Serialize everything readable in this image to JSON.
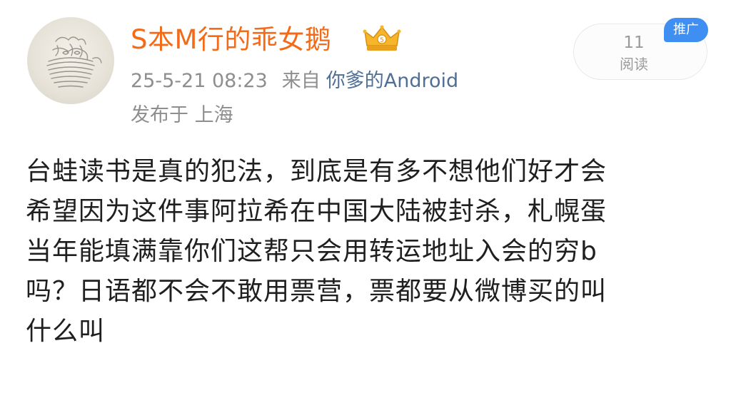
{
  "post": {
    "author": {
      "name": "S本M行的乖女鹅",
      "badge_icon": "crown-icon"
    },
    "meta": {
      "time": "25-5-21 08:23",
      "from_label": "来自",
      "source": "你爹的Android",
      "location": "发布于 上海"
    },
    "stats": {
      "read_count": "11",
      "read_label": "阅读",
      "promo_label": "推广"
    },
    "body_lines": [
      "台蛙读书是真的犯法，到底是有多不想他们好才会",
      "希望因为这件事阿拉希在中国大陆被封杀，札幌蛋",
      "当年能填满靠你们这帮只会用转运地址入会的穷b",
      "吗？日语都不会不敢用票营，票都要从微博买的叫",
      "什么叫"
    ]
  },
  "colors": {
    "username": "#f36a18",
    "meta_text": "#8e8e8e",
    "source_link": "#4f6f96",
    "body_text": "#1f1f1f",
    "promo_badge": "#3f8ef1"
  }
}
